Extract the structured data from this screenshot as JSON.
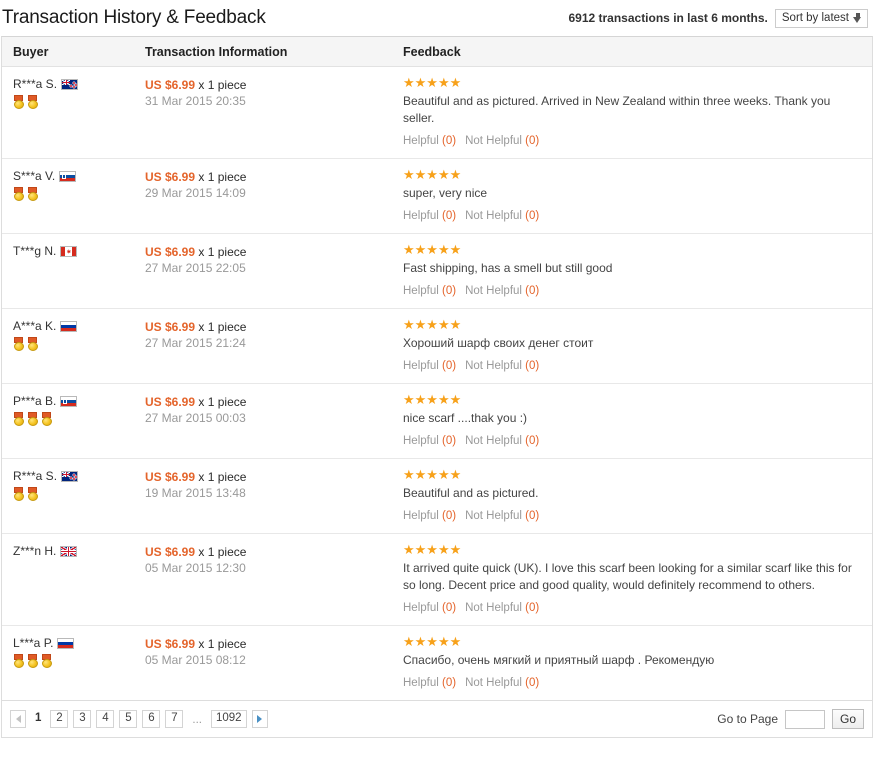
{
  "header": {
    "title": "Transaction History & Feedback",
    "transaction_count_text": "6912 transactions in last 6 months.",
    "sort_label": "Sort by latest"
  },
  "columns": {
    "buyer": "Buyer",
    "transaction": "Transaction Information",
    "feedback": "Feedback"
  },
  "labels": {
    "helpful": "Helpful",
    "not_helpful": "Not Helpful",
    "quantity_suffix": "x 1 piece"
  },
  "colors": {
    "price": "#e4642b",
    "star": "#f7a11a",
    "muted": "#999999",
    "header_bg": "#f5f5f5"
  },
  "rows": [
    {
      "buyer": "R***a S.",
      "flag": "new-zealand",
      "medals": 2,
      "price": "US $6.99",
      "quantity": "x 1 piece",
      "date": "31 Mar 2015 20:35",
      "stars": 5,
      "feedback": "Beautiful and as pictured. Arrived in New Zealand within three weeks. Thank you seller.",
      "helpful": "Helpful",
      "helpful_count": "(0)",
      "not_helpful": "Not Helpful",
      "not_helpful_count": "(0)"
    },
    {
      "buyer": "S***a V.",
      "flag": "slovenia",
      "medals": 2,
      "price": "US $6.99",
      "quantity": "x 1 piece",
      "date": "29 Mar 2015 14:09",
      "stars": 5,
      "feedback": "super, very nice",
      "helpful": "Helpful",
      "helpful_count": "(0)",
      "not_helpful": "Not Helpful",
      "not_helpful_count": "(0)"
    },
    {
      "buyer": "T***g N.",
      "flag": "canada",
      "medals": 0,
      "price": "US $6.99",
      "quantity": "x 1 piece",
      "date": "27 Mar 2015 22:05",
      "stars": 5,
      "feedback": "Fast shipping, has a smell but still good",
      "helpful": "Helpful",
      "helpful_count": "(0)",
      "not_helpful": "Not Helpful",
      "not_helpful_count": "(0)"
    },
    {
      "buyer": "A***a K.",
      "flag": "russia",
      "medals": 2,
      "price": "US $6.99",
      "quantity": "x 1 piece",
      "date": "27 Mar 2015 21:24",
      "stars": 5,
      "feedback": "Хороший шарф своих денег стоит",
      "helpful": "Helpful",
      "helpful_count": "(0)",
      "not_helpful": "Not Helpful",
      "not_helpful_count": "(0)"
    },
    {
      "buyer": "P***a B.",
      "flag": "slovenia",
      "medals": 3,
      "price": "US $6.99",
      "quantity": "x 1 piece",
      "date": "27 Mar 2015 00:03",
      "stars": 5,
      "feedback": "nice scarf ....thak you :)",
      "helpful": "Helpful",
      "helpful_count": "(0)",
      "not_helpful": "Not Helpful",
      "not_helpful_count": "(0)"
    },
    {
      "buyer": "R***a S.",
      "flag": "new-zealand",
      "medals": 2,
      "price": "US $6.99",
      "quantity": "x 1 piece",
      "date": "19 Mar 2015 13:48",
      "stars": 5,
      "feedback": "Beautiful and as pictured.",
      "helpful": "Helpful",
      "helpful_count": "(0)",
      "not_helpful": "Not Helpful",
      "not_helpful_count": "(0)"
    },
    {
      "buyer": "Z***n H.",
      "flag": "united-kingdom",
      "medals": 0,
      "price": "US $6.99",
      "quantity": "x 1 piece",
      "date": "05 Mar 2015 12:30",
      "stars": 5,
      "feedback": "It arrived quite quick (UK). I love this scarf been looking for a similar scarf like this for so long. Decent price and good quality, would definitely recommend to others.",
      "helpful": "Helpful",
      "helpful_count": "(0)",
      "not_helpful": "Not Helpful",
      "not_helpful_count": "(0)"
    },
    {
      "buyer": "L***a P.",
      "flag": "russia",
      "medals": 3,
      "price": "US $6.99",
      "quantity": "x 1 piece",
      "date": "05 Mar 2015 08:12",
      "stars": 5,
      "feedback": "Спасибо, очень мягкий и приятный шарф . Рекомендую",
      "helpful": "Helpful",
      "helpful_count": "(0)",
      "not_helpful": "Not Helpful",
      "not_helpful_count": "(0)"
    }
  ],
  "pagination": {
    "pages": [
      "1",
      "2",
      "3",
      "4",
      "5",
      "6",
      "7"
    ],
    "current": "1",
    "ellipsis": "...",
    "last_page": "1092",
    "goto_label": "Go to Page",
    "goto_value": "",
    "goto_placeholder": "",
    "go_label": "Go"
  }
}
